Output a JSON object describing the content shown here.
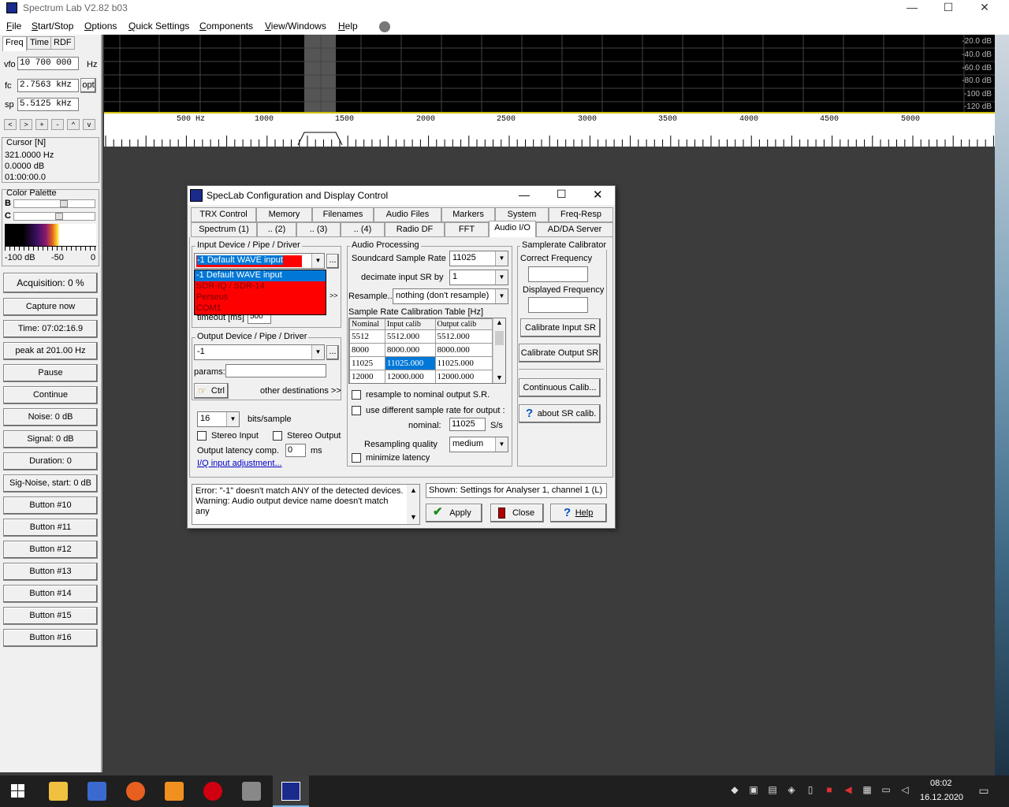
{
  "window": {
    "title": "Spectrum Lab V2.82 b03",
    "minimize": "—",
    "maximize": "☐",
    "close": "✕"
  },
  "menu": [
    "File",
    "Start/Stop",
    "Options",
    "Quick Settings",
    "Components",
    "View/Windows",
    "Help"
  ],
  "left": {
    "tabs": [
      "Freq",
      "Time",
      "RDF"
    ],
    "vfo_label": "vfo",
    "vfo_value": "10 700 000",
    "vfo_unit": "Hz",
    "fc_label": "fc",
    "fc_value": "2.7563 kHz",
    "opt_button": "opt",
    "sp_label": "sp",
    "sp_value": "5.5125 kHz",
    "nav_buttons": [
      "<",
      ">",
      "+",
      "-",
      "^",
      "v"
    ],
    "cursor_title": "Cursor [N]",
    "cursor_freq": "321.0000 Hz",
    "cursor_db": "0.0000 dB",
    "cursor_time": "01:00:00.0",
    "palette_title": "Color Palette",
    "palette_b": "B",
    "palette_c": "C",
    "palette_scale": [
      "-100 dB",
      "-50",
      "0"
    ],
    "buttons": [
      "Acquisition: 0 %",
      "Capture now",
      "Time:  07:02:16.9",
      "peak at 201.00 Hz",
      "Pause",
      "Continue",
      "Noise:  0 dB",
      "Signal:  0 dB",
      "Duration: 0",
      "Sig-Noise, start: 0 dB",
      "Button #10",
      "Button #11",
      "Button #12",
      "Button #13",
      "Button #14",
      "Button #15",
      "Button #16"
    ]
  },
  "spectrum": {
    "db_labels": [
      "-20.0 dB",
      "-40.0 dB",
      "-60.0 dB",
      "-80.0 dB",
      "-100 dB",
      "-120 dB"
    ],
    "freq_labels": [
      "500 Hz",
      "1000",
      "1500",
      "2000",
      "2500",
      "3000",
      "3500",
      "4000",
      "4500",
      "5000"
    ]
  },
  "dialog": {
    "title": "SpecLab  Configuration and Display Control",
    "tabs_row1": [
      "TRX Control",
      "Memory",
      "Filenames",
      "Audio Files",
      "Markers",
      "System",
      "Freq-Resp"
    ],
    "tabs_row2": [
      "Spectrum (1)",
      ".. (2)",
      ".. (3)",
      ".. (4)",
      "Radio DF",
      "FFT",
      "Audio I/O",
      "AD/DA Server"
    ],
    "input": {
      "legend": "Input Device / Pipe / Driver",
      "selected": "-1 Default WAVE input",
      "options": [
        "-1 Default WAVE input",
        "SDR-IQ / SDR-14",
        "Perseus",
        "COM1"
      ],
      "dots": "...",
      "more": ">>",
      "timeout_label": "timeout [ms]",
      "timeout_value": "500"
    },
    "output": {
      "legend": "Output Device / Pipe / Driver",
      "selected": "-1",
      "dots": "...",
      "params_label": "params:",
      "params_value": "",
      "ctrl_button": "Ctrl",
      "other_dest": "other destinations >>"
    },
    "bits": {
      "value": "16",
      "label": "bits/sample"
    },
    "stereo_input": "Stereo Input",
    "stereo_output": "Stereo Output",
    "latency_label": "Output latency comp.",
    "latency_value": "0",
    "latency_unit": "ms",
    "iq_link": "I/Q input adjustment...",
    "audio": {
      "legend": "Audio Processing",
      "sr_label": "Soundcard Sample Rate",
      "sr_value": "11025",
      "decimate_label": "decimate input SR by",
      "decimate_value": "1",
      "resample_label": "Resample..",
      "resample_value": "nothing (don't resample)",
      "table_title": "Sample Rate Calibration Table [Hz]",
      "table_headers": [
        "Nominal",
        "Input calib",
        "Output calib"
      ],
      "table_rows": [
        [
          "5512",
          "5512.000",
          "5512.000"
        ],
        [
          "8000",
          "8000.000",
          "8000.000"
        ],
        [
          "11025",
          "11025.000",
          "11025.000"
        ],
        [
          "12000",
          "12000.000",
          "12000.000"
        ]
      ],
      "resample_nominal": "resample to nominal output S.R.",
      "use_diff": "use different sample rate for output :",
      "nominal_label": "nominal:",
      "nominal_value": "11025",
      "nominal_unit": "S/s",
      "quality_label": "Resampling quality",
      "quality_value": "medium",
      "min_latency": "minimize latency"
    },
    "calib": {
      "legend": "Samplerate Calibrator",
      "correct_label": "Correct Frequency",
      "displayed_label": "Displayed Frequency",
      "cal_input": "Calibrate Input SR",
      "cal_output": "Calibrate Output SR",
      "continuous": "Continuous Calib...",
      "about": "about SR calib."
    },
    "messages": "Error: \"-1\" doesn't match ANY of the detected devices.\nWarning: Audio output device name doesn't match any",
    "shown": "Shown: Settings for Analyser 1, channel 1 (L)",
    "apply": "Apply",
    "close": "Close",
    "help": "Help"
  },
  "taskbar": {
    "time": "08:02",
    "date": "16.12.2020"
  },
  "colors": {
    "selection": "#0078d7",
    "dropdown_bg": "#ff0000",
    "spectrum_bg": "#000000",
    "workspace": "#3c3c3c"
  }
}
